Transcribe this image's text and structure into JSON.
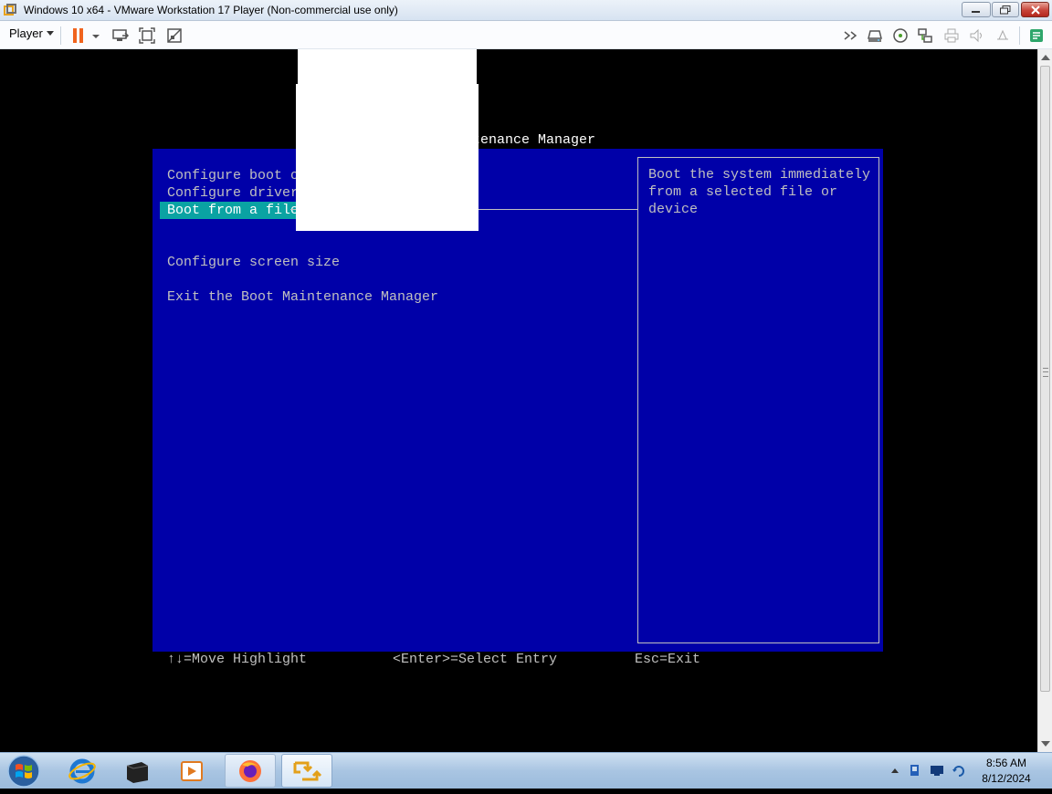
{
  "window": {
    "title": "Windows 10 x64 - VMware Workstation 17 Player (Non-commercial use only)",
    "controls": [
      "minimize",
      "maximize",
      "close"
    ]
  },
  "toolbar": {
    "player_menu_label": "Player",
    "icons": [
      "pause-icon",
      "dropdown-caret-icon",
      "send-ctrl-alt-del-icon",
      "full-screen-icon",
      "unity-icon",
      "forward-icon",
      "hard-disk-icon",
      "cd-dvd-icon",
      "network-adapter-icon",
      "printer-icon",
      "sound-card-icon",
      "usb-icon",
      "message-log-icon"
    ]
  },
  "uefi": {
    "title": "ntenance Manager",
    "menu": [
      {
        "label": "Configure boot opt",
        "selected": false
      },
      {
        "label": "Configure drivers",
        "selected": false
      },
      {
        "label": "Boot from a file",
        "selected": true
      },
      {
        "label": "Configure screen size",
        "selected": false
      },
      {
        "label": "Exit the Boot Maintenance Manager",
        "selected": false
      }
    ],
    "help_text": "Boot the system immediately\nfrom a selected file or\ndevice",
    "hints": {
      "move": "↑↓=Move Highlight",
      "select": "<Enter>=Select Entry",
      "exit": "Esc=Exit"
    },
    "colors": {
      "background": "#0000a8",
      "selection": "#0aa3a3",
      "text": "#c0c0c0"
    }
  },
  "taskbar": {
    "apps": [
      "start-orb",
      "internet-explorer",
      "terminal",
      "media-player",
      "firefox",
      "vmware-player"
    ],
    "clock": {
      "time": "8:56 AM",
      "date": "8/12/2024"
    }
  }
}
